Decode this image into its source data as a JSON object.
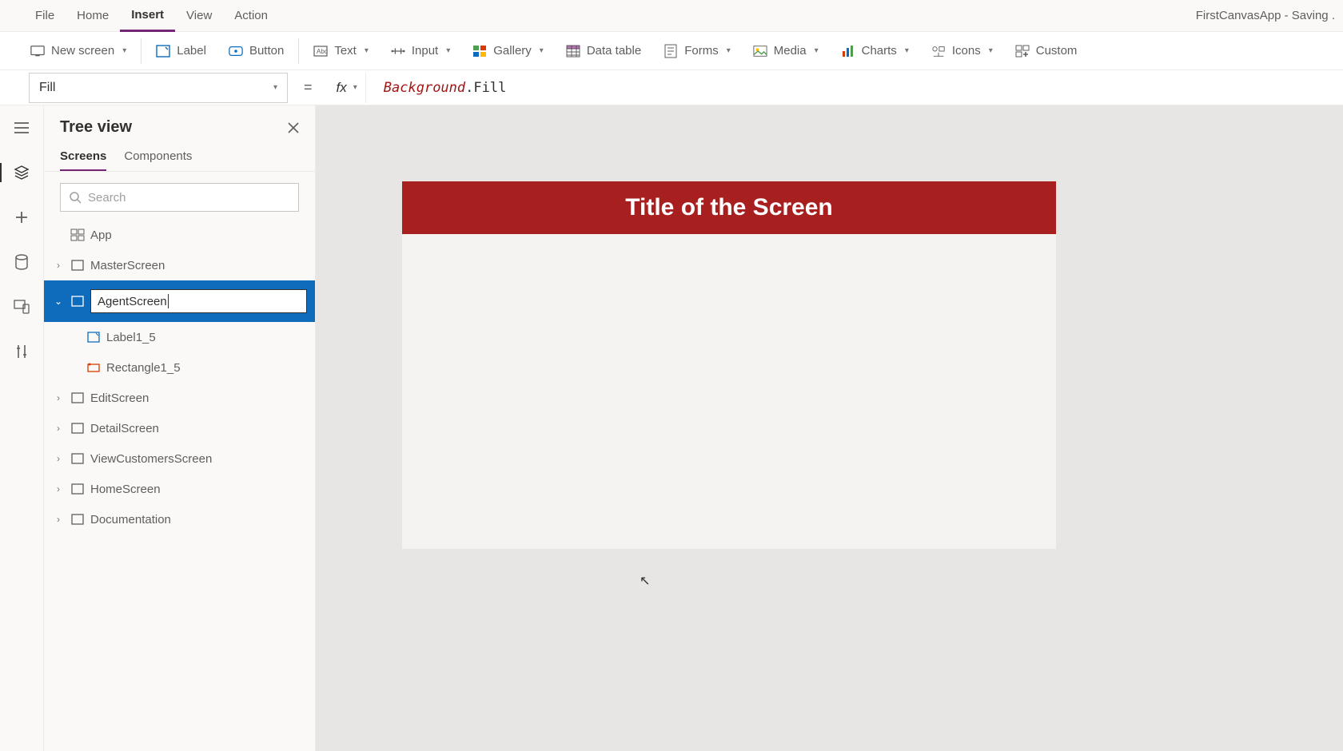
{
  "app_title": "FirstCanvasApp - Saving .",
  "menus": {
    "file": "File",
    "home": "Home",
    "insert": "Insert",
    "view": "View",
    "action": "Action"
  },
  "ribbon": {
    "new_screen": "New screen",
    "label": "Label",
    "button": "Button",
    "text": "Text",
    "input": "Input",
    "gallery": "Gallery",
    "data_table": "Data table",
    "forms": "Forms",
    "media": "Media",
    "charts": "Charts",
    "icons": "Icons",
    "custom": "Custom"
  },
  "formula": {
    "property": "Fill",
    "fx": "fx",
    "expr_obj": "Background",
    "expr_rest": ".Fill"
  },
  "tree": {
    "title": "Tree view",
    "tab_screens": "Screens",
    "tab_components": "Components",
    "search_placeholder": "Search",
    "app_node": "App",
    "items": {
      "master": "MasterScreen",
      "agent_edit": "AgentScreen",
      "label1_5": "Label1_5",
      "rect1_5": "Rectangle1_5",
      "edit": "EditScreen",
      "detail": "DetailScreen",
      "viewcust": "ViewCustomersScreen",
      "home": "HomeScreen",
      "doc": "Documentation"
    }
  },
  "canvas": {
    "title": "Title of the Screen"
  }
}
